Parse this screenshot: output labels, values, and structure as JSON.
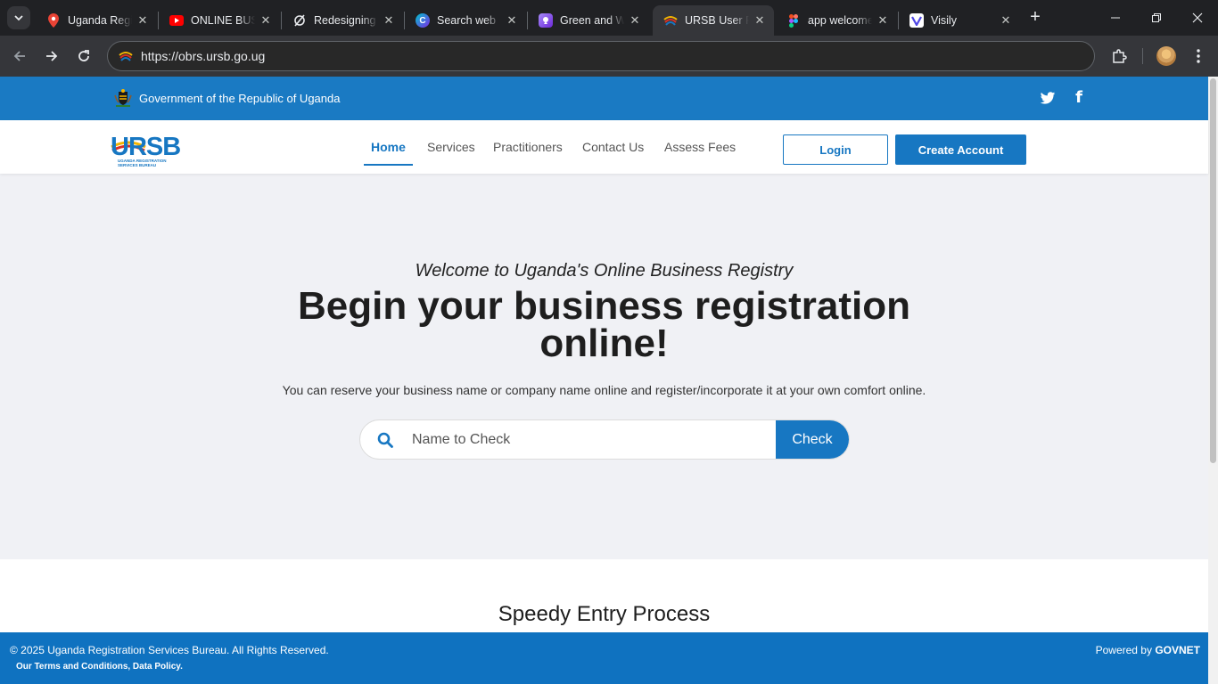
{
  "browser": {
    "tabs": [
      {
        "label": "Uganda Registration",
        "icon": "maps-pin-icon",
        "color": "#34a853",
        "active": false
      },
      {
        "label": "ONLINE BUSINESS",
        "icon": "youtube-icon",
        "color": "#ff0000",
        "active": false
      },
      {
        "label": "Redesigning",
        "icon": "pen-tool-icon",
        "color": "#e8eaed",
        "active": false
      },
      {
        "label": "Search web",
        "icon": "canva-icon",
        "color": "#7d2ae8",
        "active": false
      },
      {
        "label": "Green and White",
        "icon": "app-icon",
        "color": "#8b5cf6",
        "active": false
      },
      {
        "label": "URSB User Portal",
        "icon": "ursb-icon",
        "color": "#1777c2",
        "active": true
      },
      {
        "label": "app welcome",
        "icon": "figma-icon",
        "color": "#f24e1e",
        "active": false
      },
      {
        "label": "Visily",
        "icon": "visily-icon",
        "color": "#ffffff",
        "active": false
      }
    ],
    "url": "https://obrs.ursb.go.ug"
  },
  "gov_bar": {
    "text": "Government of the Republic of Uganda"
  },
  "nav": {
    "logo_text": "URSB",
    "logo_sub": "UGANDA REGISTRATION SERVICES BUREAU",
    "links": [
      "Home",
      "Services",
      "Practitioners",
      "Contact Us",
      "Assess Fees"
    ],
    "active": "Home",
    "login_label": "Login",
    "create_label": "Create Account"
  },
  "hero": {
    "eyebrow": "Welcome to Uganda's Online Business Registry",
    "title": "Begin your business registration online!",
    "description": "You can reserve your business name or company name online and register/incorporate it at your own comfort online.",
    "search_placeholder": "Name to Check",
    "check_label": "Check"
  },
  "section": {
    "title": "Speedy Entry Process"
  },
  "footer": {
    "copyright": "© 2025 Uganda Registration Services Bureau. All Rights Reserved.",
    "links": "Our Terms and Conditions, Data Policy.",
    "powered_prefix": "Powered by",
    "powered_brand": "GOVNET"
  },
  "colors": {
    "brand_blue": "#1777c2",
    "hero_bg": "#f0f1f5"
  }
}
